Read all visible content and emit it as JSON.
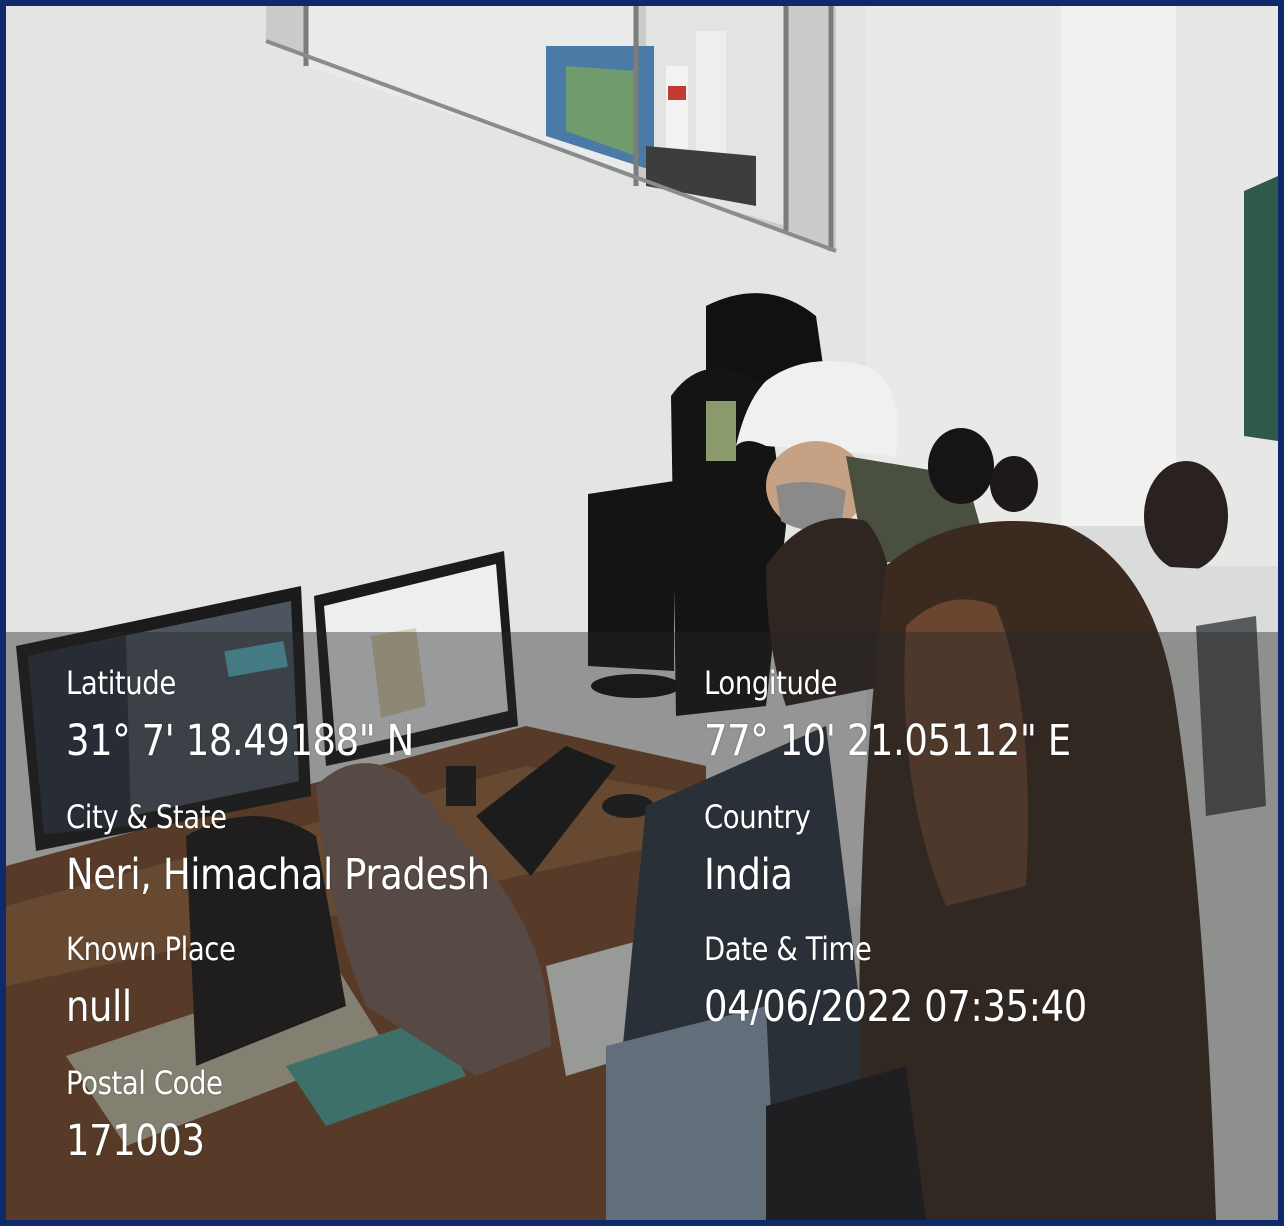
{
  "location_stamp": {
    "latitude": {
      "label": "Latitude",
      "value": "31° 7' 18.49188\" N"
    },
    "longitude": {
      "label": "Longitude",
      "value": "77° 10' 21.05112\" E"
    },
    "city_state": {
      "label": "City & State",
      "value": "Neri, Himachal Pradesh"
    },
    "country": {
      "label": "Country",
      "value": "India"
    },
    "known_place": {
      "label": "Known Place",
      "value": "null"
    },
    "date_time": {
      "label": "Date & Time",
      "value": "04/06/2022 07:35:40"
    },
    "postal_code": {
      "label": "Postal Code",
      "value": "171003"
    }
  },
  "colors": {
    "frame": "#0f2a6b",
    "overlay": "rgba(38,38,38,0.42)",
    "text": "#ffffff"
  }
}
